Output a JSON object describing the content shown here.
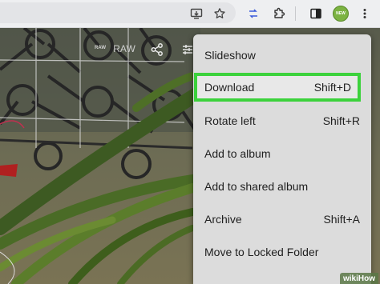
{
  "toolbar": {
    "icons": [
      "install-app-icon",
      "bookmark-star-icon",
      "tab-search-icon",
      "extensions-puzzle-icon",
      "side-panel-icon",
      "profile-avatar",
      "more-options-icon"
    ],
    "avatar_text": "NEW"
  },
  "viewer": {
    "raw_badge": "RAW",
    "raw_label": "RAW",
    "icons": [
      "share-icon",
      "adjust-icon"
    ]
  },
  "menu": {
    "items": [
      {
        "label": "Slideshow",
        "shortcut": ""
      },
      {
        "label": "Download",
        "shortcut": "Shift+D",
        "highlighted": true
      },
      {
        "label": "Rotate left",
        "shortcut": "Shift+R"
      },
      {
        "label": "Add to album",
        "shortcut": ""
      },
      {
        "label": "Add to shared album",
        "shortcut": ""
      },
      {
        "label": "Archive",
        "shortcut": "Shift+A"
      },
      {
        "label": "Move to Locked Folder",
        "shortcut": ""
      }
    ]
  },
  "watermark": "wikiHow",
  "colors": {
    "highlight_border": "#3cd23c",
    "menu_bg": "#dcdcdc",
    "toolbar_bg": "#eeeff1",
    "avatar_bg": "#7cb342"
  }
}
